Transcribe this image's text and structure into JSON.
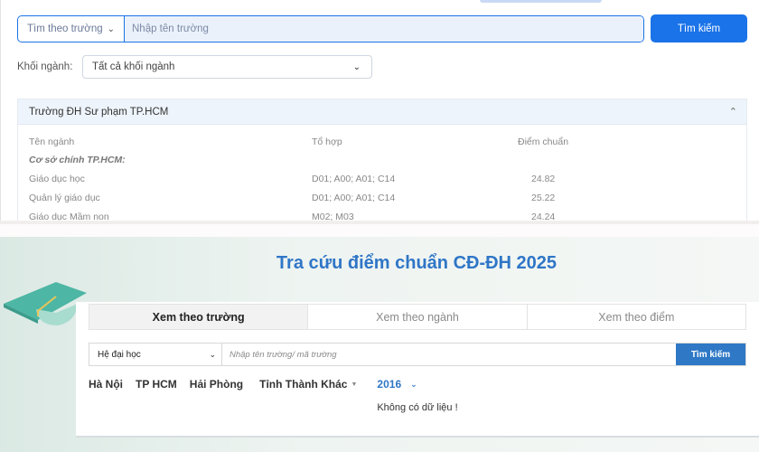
{
  "top": {
    "search_select_label": "Tìm theo trường",
    "search_placeholder": "Nhập tên trường",
    "search_button": "Tìm kiếm",
    "khoi_label": "Khối ngành:",
    "khoi_select_value": "Tất cả khối ngành",
    "result": {
      "school_name": "Trường ĐH Sư phạm TP.HCM",
      "headers": [
        "Tên ngành",
        "Tổ hợp",
        "Điểm chuẩn"
      ],
      "section": "Cơ sở chính TP.HCM:",
      "rows": [
        {
          "name": "Giáo dục học",
          "combo": "D01; A00; A01; C14",
          "score": "24.82"
        },
        {
          "name": "Quản lý giáo dục",
          "combo": "D01; A00; A01; C14",
          "score": "25.22"
        },
        {
          "name": "Giáo dục Mầm non",
          "combo": "M02; M03",
          "score": "24.24"
        }
      ]
    }
  },
  "bottom": {
    "title": "Tra cứu điểm chuẩn CĐ-ĐH 2025",
    "tabs": [
      "Xem theo trường",
      "Xem theo ngành",
      "Xem theo điểm"
    ],
    "he_select": "Hệ đại học",
    "search_placeholder": "Nhập tên trường/ mã trường",
    "search_button": "Tìm kiếm",
    "regions": [
      "Hà Nội",
      "TP HCM",
      "Hải Phòng"
    ],
    "region_more": "Tỉnh Thành Khác",
    "year": "2016",
    "no_data": "Không có dữ liệu !"
  },
  "colors": {
    "primary_blue": "#1a73e8",
    "title_blue": "#2f76c7",
    "button_blue": "#2e78c6",
    "cap_teal": "#4db6a4"
  }
}
